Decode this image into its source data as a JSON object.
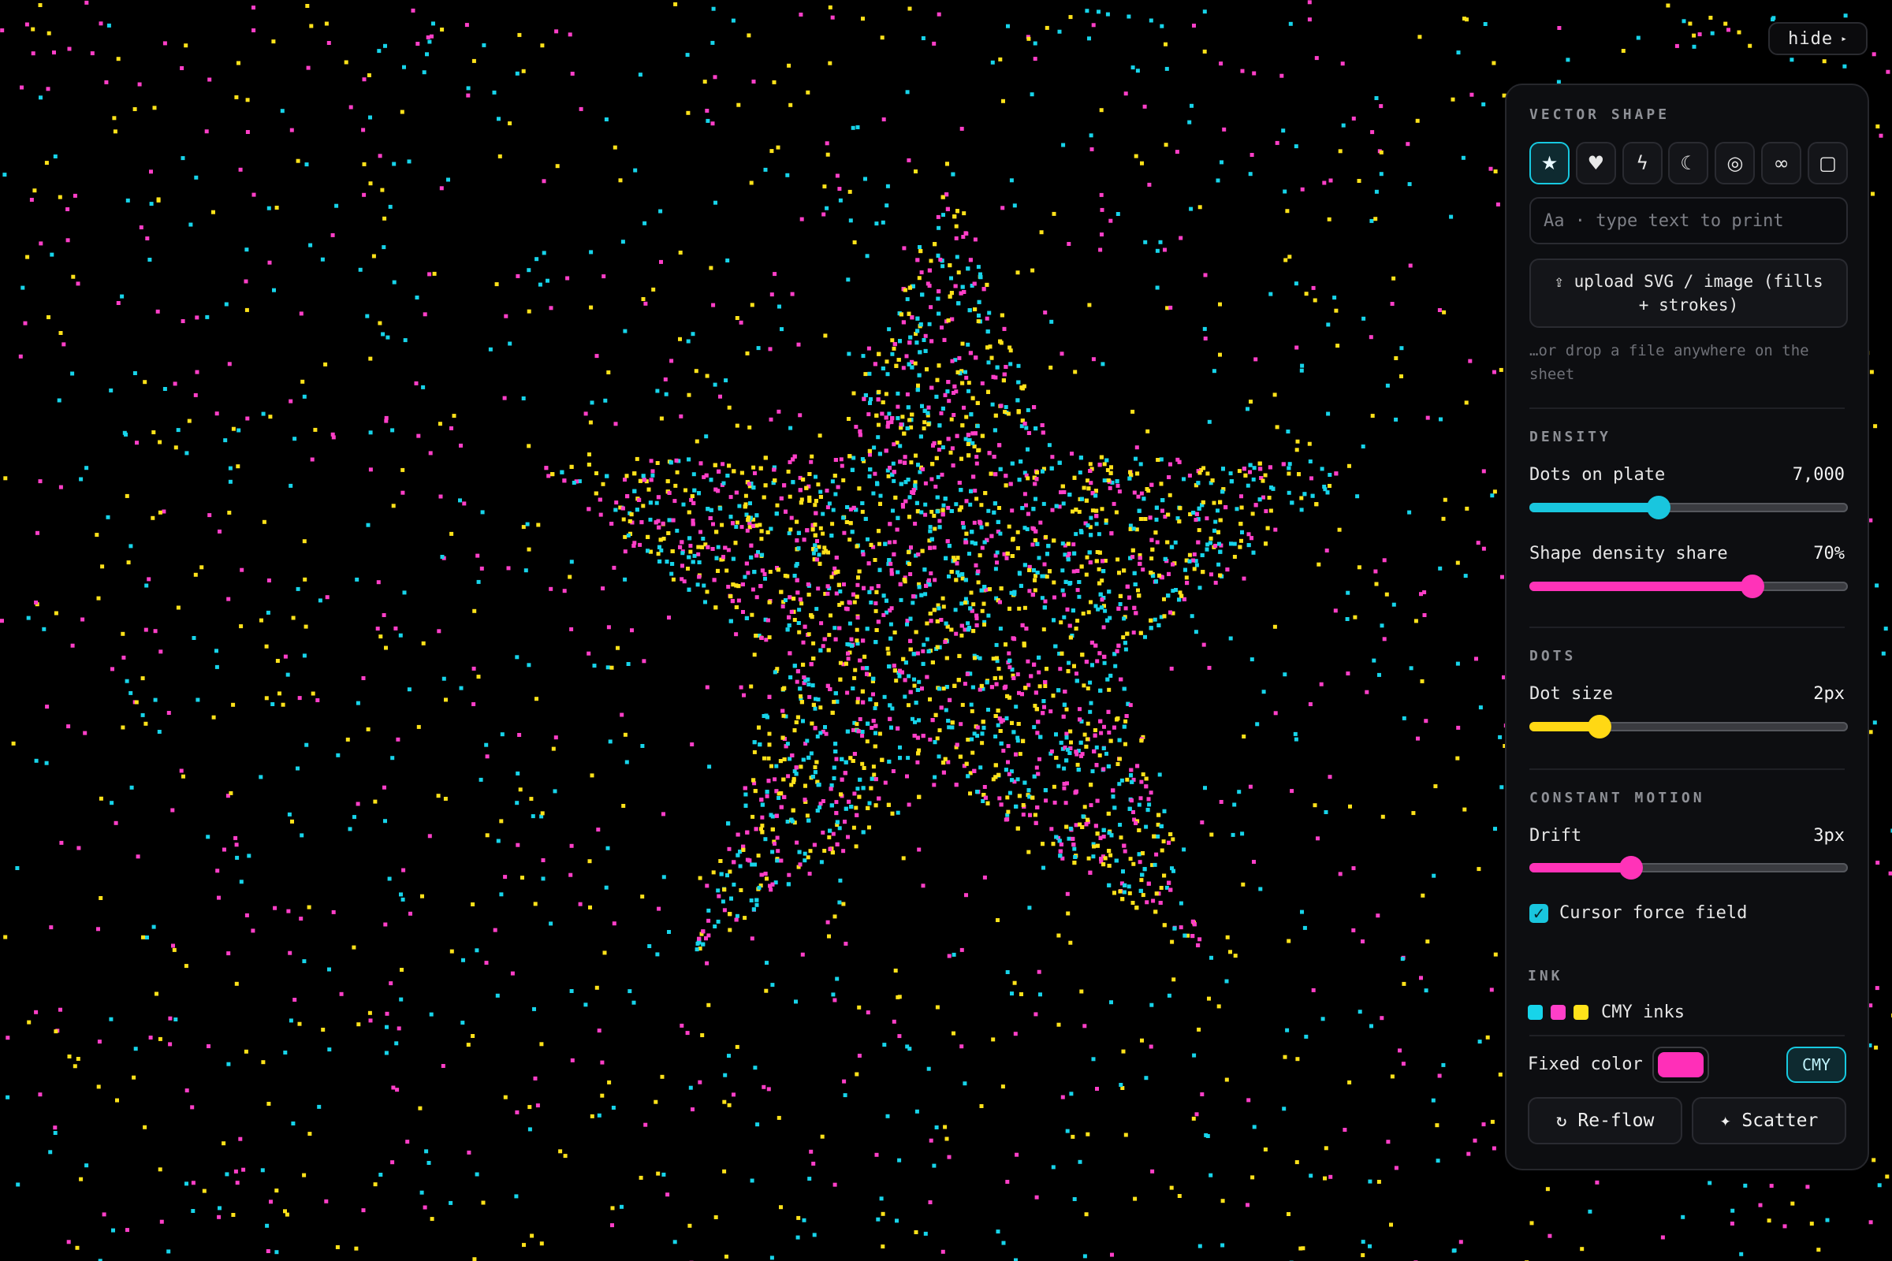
{
  "hide_button": {
    "label": "hide",
    "arrow": "▸"
  },
  "panel": {
    "vector_shape": {
      "title": "VECTOR SHAPE",
      "shapes": [
        {
          "icon": "star-icon",
          "glyph": "★",
          "active": true
        },
        {
          "icon": "heart-icon",
          "glyph": "♥",
          "active": false
        },
        {
          "icon": "lightning-icon",
          "glyph": "ϟ",
          "active": false
        },
        {
          "icon": "moon-icon",
          "glyph": "☾",
          "active": false
        },
        {
          "icon": "ring-icon",
          "glyph": "◎",
          "active": false
        },
        {
          "icon": "infinity-icon",
          "glyph": "∞",
          "active": false
        },
        {
          "icon": "square-icon",
          "glyph": "▢",
          "active": false
        }
      ],
      "text_placeholder": "Aa · type text to print",
      "upload_label": "⇪ upload SVG / image (fills + strokes)",
      "drop_hint": "…or drop a file anywhere on the sheet"
    },
    "density": {
      "title": "DENSITY",
      "dots_label": "Dots on plate",
      "dots_value": "7,000",
      "dots_fraction": 0.405,
      "share_label": "Shape density share",
      "share_value": "70%",
      "share_fraction": 0.7
    },
    "dots": {
      "title": "DOTS",
      "size_label": "Dot size",
      "size_value": "2px",
      "size_fraction": 0.22
    },
    "motion": {
      "title": "CONSTANT MOTION",
      "drift_label": "Drift",
      "drift_value": "3px",
      "drift_fraction": 0.32,
      "cursor_label": "Cursor force field",
      "cursor_checked": true
    },
    "ink": {
      "title": "INK",
      "inks_label": "CMY inks",
      "fixed_label": "Fixed color",
      "fixed_color": "#ff2fb8",
      "cmy_button": "CMY"
    },
    "actions": {
      "reflow_label": "↻ Re-flow",
      "scatter_label": "✦ Scatter"
    }
  },
  "colors": {
    "cyan": "#17d4ea",
    "magenta": "#ff3fc8",
    "yellow": "#ffe21a",
    "knob_cyan": "#19c6de",
    "knob_magenta": "#ff33b8",
    "knob_yellow": "#ffd814"
  }
}
